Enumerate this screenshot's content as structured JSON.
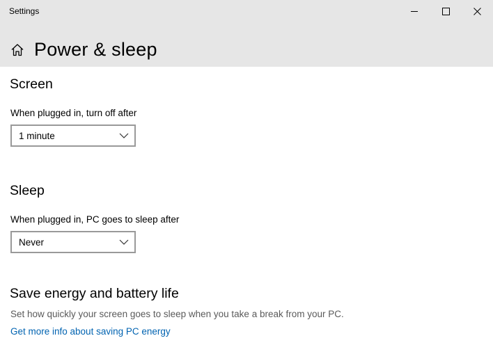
{
  "window": {
    "title": "Settings"
  },
  "header": {
    "page_title": "Power & sleep"
  },
  "screen_section": {
    "heading": "Screen",
    "label": "When plugged in, turn off after",
    "value": "1 minute"
  },
  "sleep_section": {
    "heading": "Sleep",
    "label": "When plugged in, PC goes to sleep after",
    "value": "Never"
  },
  "energy_section": {
    "heading": "Save energy and battery life",
    "description": "Set how quickly your screen goes to sleep when you take a break from your PC.",
    "link": "Get more info about saving PC energy"
  },
  "colors": {
    "titlebar_bg": "#e6e6e6",
    "link": "#0063b1",
    "dropdown_border": "#999999"
  },
  "icons": [
    "home-icon",
    "minimize-icon",
    "maximize-icon",
    "close-icon",
    "chevron-down-icon"
  ]
}
